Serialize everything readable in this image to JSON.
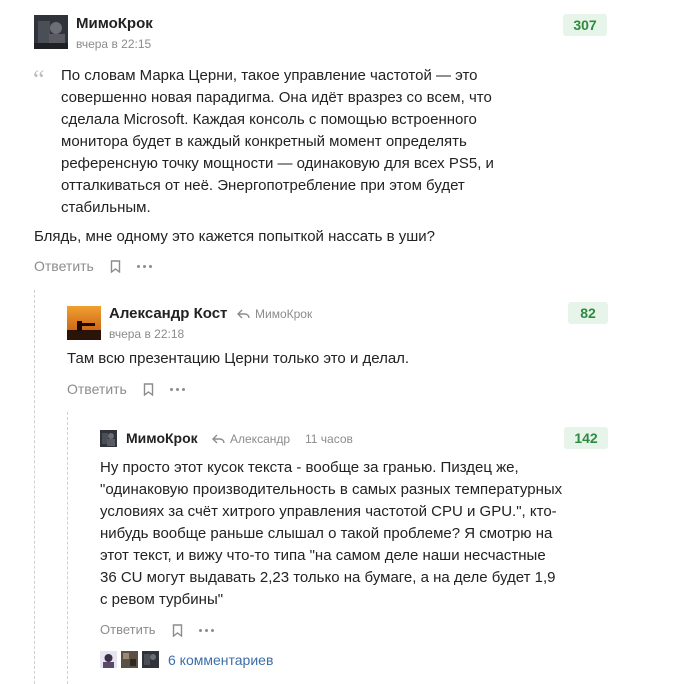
{
  "comments": [
    {
      "author": "МимоКрок",
      "time": "вчера в 22:15",
      "score": "307",
      "quote": "По словам Марка Церни, такое управление частотой — это совершенно новая парадигма. Она идёт вразрез со всем, что сделала Microsoft. Каждая консоль с помощью встроенного монитора будет в каждый конкретный момент определять референсную точку мощности — одинаковую для всех PS5, и отталкиваться от неё. Энергопотребление при этом будет стабильным.",
      "text": "Блядь, мне одному это кажется попыткой нассать в уши?",
      "reply_label": "Ответить"
    },
    {
      "author": "Александр Кост",
      "reply_to": "МимоКрок",
      "time": "вчера в 22:18",
      "score": "82",
      "text": "Там всю презентацию Церни только это и делал.",
      "reply_label": "Ответить"
    },
    {
      "author": "МимоКрок",
      "reply_to": "Александр",
      "time": "11 часов",
      "score": "142",
      "text": "Ну просто этот кусок текста - вообще за гранью. Пиздец же, \"одинаковую производительность в самых разных температурных условиях за счёт хитрого управления частотой CPU и GPU.\", кто-нибудь вообще раньше слышал о такой проблеме? Я смотрю на этот текст, и вижу что-то типа \"на самом деле наши несчастные 36 CU могут выдавать 2,23 только на бумаге, а на деле будет 1,9 с ревом турбины\"",
      "reply_label": "Ответить"
    }
  ],
  "more_comments": "6 комментариев",
  "colors": {
    "score_bg": "#e6f4ea",
    "score_text": "#2e8b3e",
    "muted": "#8c8c8c",
    "link": "#3b6ea8"
  }
}
